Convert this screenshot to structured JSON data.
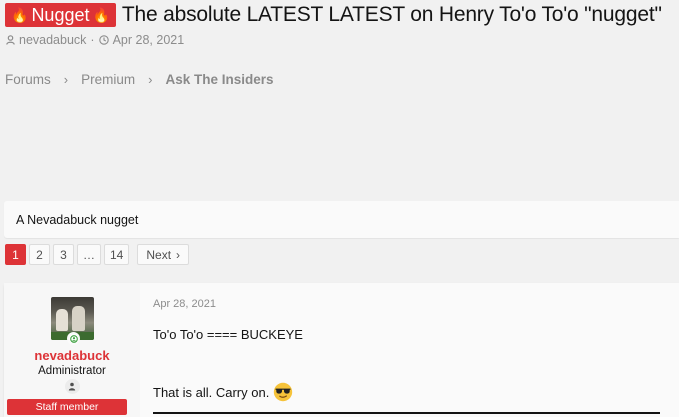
{
  "thread": {
    "prefix": "Nugget",
    "title": "The absolute LATEST LATEST on Henry To'o To'o \"nugget\"",
    "author": "nevadabuck",
    "separator": "·",
    "date": "Apr 28, 2021"
  },
  "breadcrumb": {
    "items": [
      "Forums",
      "Premium",
      "Ask The Insiders"
    ],
    "sep": "›"
  },
  "description": "A Nevadabuck nugget",
  "pagination": {
    "pages": [
      "1",
      "2",
      "3",
      "…",
      "14"
    ],
    "current": "1",
    "next_label": "Next",
    "next_arrow": "›"
  },
  "post": {
    "date": "Apr 28, 2021",
    "username": "nevadabuck",
    "user_title": "Administrator",
    "banner": "Staff member",
    "line1": "To'o To'o ==== BUCKEYE",
    "line2": "That is all. Carry on."
  },
  "colors": {
    "accent": "#dd3337",
    "background": "#f1f1f1",
    "muted": "#8c8c8c"
  },
  "icons": [
    "fire-icon",
    "user-icon",
    "clock-icon",
    "chevron-right-icon",
    "online-indicator-icon",
    "moderator-icon",
    "sunglasses-emoji-icon"
  ]
}
